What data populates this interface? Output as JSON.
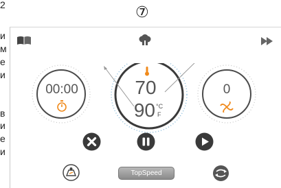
{
  "side_letters": [
    "и",
    "м",
    "е",
    "и",
    "в",
    "и",
    "е",
    "и"
  ],
  "top_left_char": "2",
  "step_number": "⑦",
  "time": {
    "value": "00:00"
  },
  "temperature": {
    "target": "70",
    "current": "90",
    "unit_c": "°C",
    "unit_f": "F"
  },
  "speed": {
    "value": "0"
  },
  "turbo_button": {
    "label": "TopSpeed"
  },
  "icons": {
    "book": "recipe-book-icon",
    "chef": "chef-hat-icon",
    "forward": "fast-forward-icon",
    "timer": "stopwatch-icon",
    "thermometer": "thermometer-icon",
    "fan": "fan-icon",
    "cancel": "cancel-icon",
    "pause": "pause-icon",
    "play": "play-icon",
    "scale": "scale-icon",
    "reverse": "reverse-rotation-icon"
  },
  "colors": {
    "accent": "#f08a1c",
    "dial_ring": "#4a4a4a",
    "dark_button": "#3a3a3a",
    "dots": "#7fb6d8"
  }
}
